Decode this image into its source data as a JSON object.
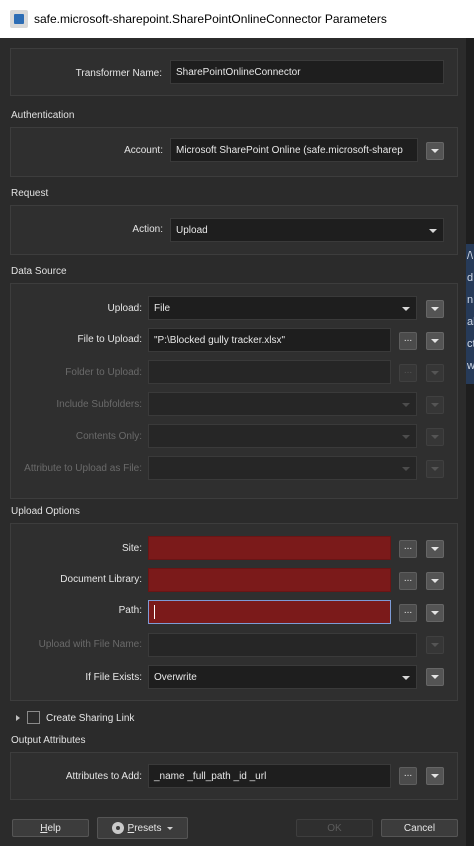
{
  "window": {
    "title": "safe.microsoft-sharepoint.SharePointOnlineConnector Parameters"
  },
  "transformer_name": {
    "label": "Transformer Name:",
    "value": "SharePointOnlineConnector"
  },
  "authentication": {
    "section_title": "Authentication",
    "account": {
      "label": "Account:",
      "value": "Microsoft SharePoint Online (safe.microsoft-sharep"
    }
  },
  "request": {
    "section_title": "Request",
    "action": {
      "label": "Action:",
      "value": "Upload"
    }
  },
  "data_source": {
    "section_title": "Data Source",
    "upload": {
      "label": "Upload:",
      "value": "File"
    },
    "file_to_upload": {
      "label": "File to Upload:",
      "value": "\"P:\\Blocked gully tracker.xlsx\""
    },
    "folder_to_upload": {
      "label": "Folder to Upload:",
      "value": ""
    },
    "include_subfolders": {
      "label": "Include Subfolders:",
      "value": ""
    },
    "contents_only": {
      "label": "Contents Only:",
      "value": ""
    },
    "attribute_to_upload_as_file": {
      "label": "Attribute to Upload as File:",
      "value": ""
    }
  },
  "upload_options": {
    "section_title": "Upload Options",
    "site": {
      "label": "Site:",
      "value": ""
    },
    "document_library": {
      "label": "Document Library:",
      "value": ""
    },
    "path": {
      "label": "Path:",
      "value": ""
    },
    "upload_with_file_name": {
      "label": "Upload with File Name:",
      "value": ""
    },
    "if_file_exists": {
      "label": "If File Exists:",
      "value": "Overwrite"
    }
  },
  "create_sharing_link": {
    "label": "Create Sharing Link",
    "checked": false
  },
  "output_attributes": {
    "section_title": "Output Attributes",
    "attributes_to_add": {
      "label": "Attributes to Add:",
      "value": "_name _full_path _id _url"
    }
  },
  "buttons": {
    "help": "Help",
    "presets": "Presets",
    "ok": "OK",
    "cancel": "Cancel",
    "browse": "..."
  },
  "background_window_glyphs": [
    "/\\",
    "d",
    "n",
    "ab",
    "ct",
    "w"
  ],
  "colors": {
    "dialog_bg": "#2b2b2b",
    "required_field": "#7b1a1a",
    "focus_border": "#7d9bd6",
    "titlebar_bg": "#ffffff"
  }
}
